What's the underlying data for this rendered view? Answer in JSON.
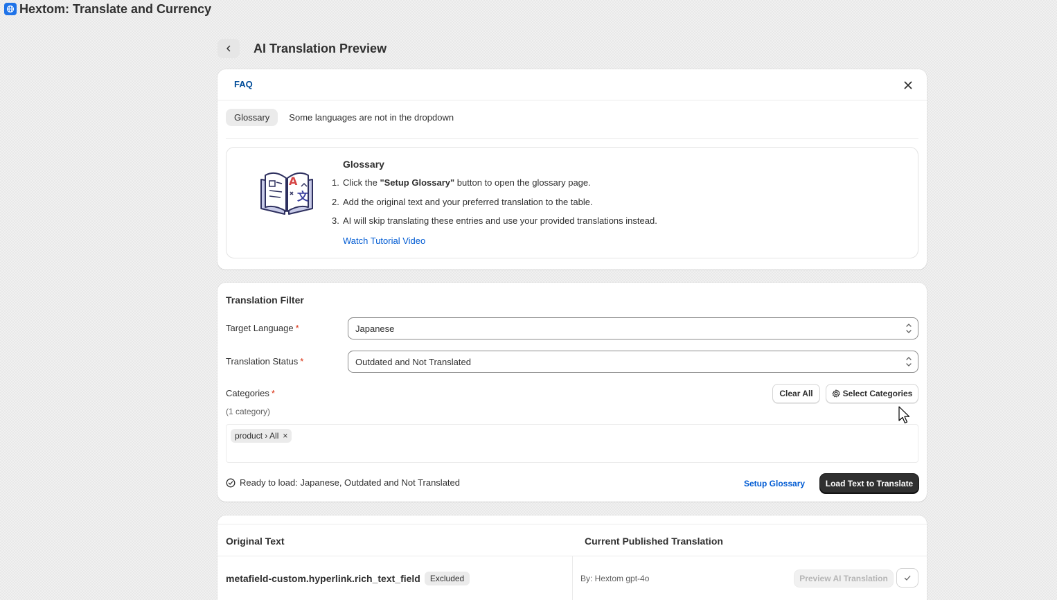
{
  "app": {
    "title": "Hextom: Translate and Currency",
    "logo_icon": "globe-icon",
    "accent": "#1f73e8"
  },
  "page": {
    "title": "AI Translation Preview",
    "back_icon": "chevron-left-icon"
  },
  "faq": {
    "title": "FAQ",
    "tabs": [
      {
        "label": "Glossary",
        "active": true
      },
      {
        "label": "Some languages are not in the dropdown",
        "active": false
      }
    ],
    "glossary": {
      "heading": "Glossary",
      "steps": [
        {
          "num": "1.",
          "pre": "Click the ",
          "bold": "\"Setup Glossary\"",
          "post": " button to open the glossary page."
        },
        {
          "num": "2.",
          "text": "Add the original text and your preferred translation to the table."
        },
        {
          "num": "3.",
          "text": "AI will skip translating these entries and use your provided translations instead."
        }
      ],
      "tutorial_link": "Watch Tutorial Video"
    }
  },
  "filter": {
    "title": "Translation Filter",
    "target_language": {
      "label": "Target Language",
      "required": "*",
      "value": "Japanese"
    },
    "translation_status": {
      "label": "Translation Status",
      "required": "*",
      "value": "Outdated and Not Translated"
    },
    "categories": {
      "label": "Categories",
      "required": "*",
      "count_text": "(1 category)",
      "clear_all": "Clear All",
      "select_categories": "Select Categories",
      "tags": [
        {
          "label": "product › All",
          "remove": "×"
        }
      ]
    },
    "ready_text": "Ready to load: Japanese, Outdated and Not Translated",
    "setup_glossary": "Setup Glossary",
    "load_button": "Load Text to Translate"
  },
  "table": {
    "columns": [
      "Original Text",
      "Current Published Translation"
    ],
    "rows": [
      {
        "key": "metafield-custom.hyperlink.rich_text_field",
        "badge": "Excluded",
        "by": "By: Hextom gpt-4o",
        "preview_button": "Preview AI Translation"
      }
    ]
  }
}
